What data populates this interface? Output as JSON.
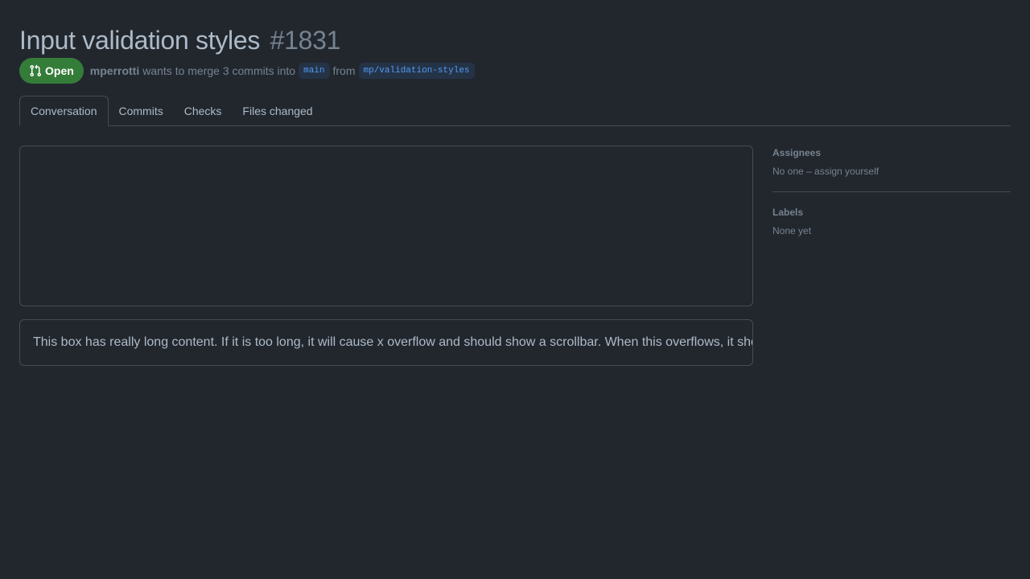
{
  "pull_request": {
    "title": "Input validation styles",
    "number": "#1831",
    "state": "Open",
    "author": "mperrotti",
    "merge_text": "wants to merge 3 commits into",
    "base_branch": "main",
    "from_text": "from",
    "head_branch": "mp/validation-styles"
  },
  "tabs": [
    {
      "label": "Conversation",
      "active": true
    },
    {
      "label": "Commits",
      "active": false
    },
    {
      "label": "Checks",
      "active": false
    },
    {
      "label": "Files changed",
      "active": false
    }
  ],
  "content": {
    "overflow_text": "This box has really long content. If it is too long, it will cause x overflow and should show a scrollbar. When this overflows, it should not break the layout or cause the page itself to scroll horizontally."
  },
  "sidebar": {
    "assignees": {
      "heading": "Assignees",
      "value": "No one – assign yourself"
    },
    "labels": {
      "heading": "Labels",
      "value": "None yet"
    }
  },
  "colors": {
    "background": "#22272e",
    "open_badge": "#347d39",
    "branch_bg": "#253347",
    "branch_text": "#539bf5",
    "border": "#444c56",
    "muted_text": "#768390",
    "primary_text": "#adbac7"
  },
  "icons": {
    "state_icon": "git-pull-request-icon"
  }
}
